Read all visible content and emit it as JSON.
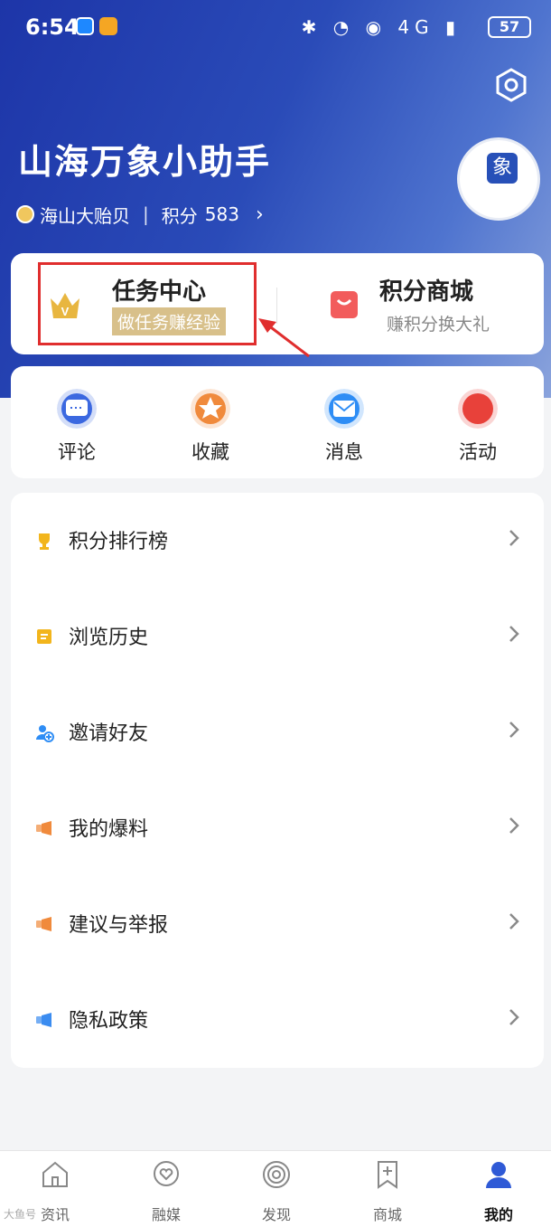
{
  "status_bar": {
    "time": "6:54",
    "icons": "✱ ◔ ◉ 4G ▮",
    "battery": "57"
  },
  "profile": {
    "name": "山海万象小助手",
    "level": "海山大贻贝",
    "points_label": "积分",
    "points_value": "583",
    "avatar_text": "象"
  },
  "features": {
    "task": {
      "title": "任务中心",
      "subtitle": "做任务赚经验"
    },
    "mall": {
      "title": "积分商城",
      "subtitle": "赚积分换大礼"
    }
  },
  "quick_actions": [
    {
      "label": "评论",
      "icon": "comment-icon",
      "color": "#3b68e0"
    },
    {
      "label": "收藏",
      "icon": "star-icon",
      "color": "#f08a3c"
    },
    {
      "label": "消息",
      "icon": "mail-icon",
      "color": "#2e8df5"
    },
    {
      "label": "活动",
      "icon": "flame-icon",
      "color": "#e8413a"
    }
  ],
  "menu": [
    {
      "label": "积分排行榜",
      "icon": "trophy-icon",
      "color": "#f2b51c"
    },
    {
      "label": "浏览历史",
      "icon": "history-icon",
      "color": "#f2b51c"
    },
    {
      "label": "邀请好友",
      "icon": "invite-icon",
      "color": "#2e8df5"
    },
    {
      "label": "我的爆料",
      "icon": "megaphone-icon",
      "color": "#f08a3c"
    },
    {
      "label": "建议与举报",
      "icon": "megaphone-icon",
      "color": "#f08a3c"
    },
    {
      "label": "隐私政策",
      "icon": "megaphone-icon",
      "color": "#3b8cf0"
    }
  ],
  "tabs": [
    {
      "label": "资讯",
      "icon": "home-icon"
    },
    {
      "label": "融媒",
      "icon": "heart-chat-icon"
    },
    {
      "label": "发现",
      "icon": "spiral-icon"
    },
    {
      "label": "商城",
      "icon": "bookmark-icon"
    },
    {
      "label": "我的",
      "icon": "user-icon"
    }
  ],
  "watermark": "大鱼号"
}
